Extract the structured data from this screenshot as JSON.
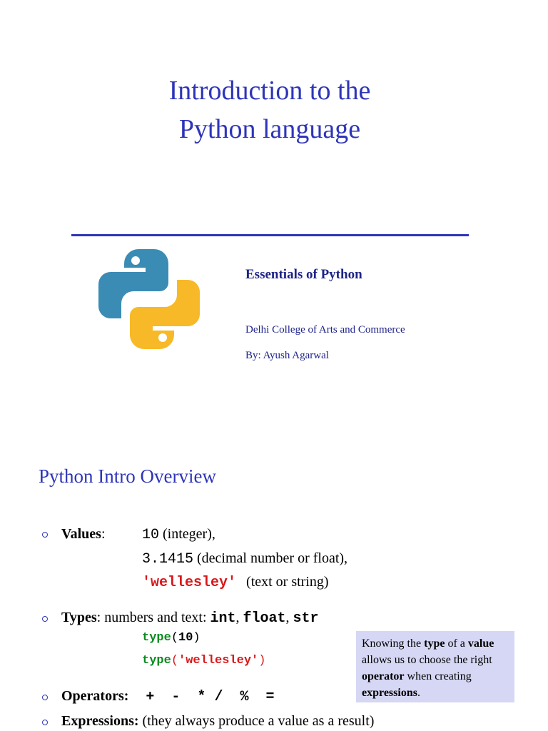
{
  "slide1": {
    "title_line1": "Introduction to the",
    "title_line2": "Python language",
    "subtitle": "Essentials of Python",
    "college": "Delhi College of Arts and Commerce",
    "author": "By: Ayush Agarwal",
    "logo_icon": "python-logo-icon",
    "colors": {
      "title": "#2e35b8",
      "logo_blue": "#3b8cb5",
      "logo_yellow": "#f7b928"
    }
  },
  "slide2": {
    "title": "Python Intro Overview",
    "values": {
      "label": "Values",
      "colon": ":",
      "v1": "10",
      "v1_desc": " (integer),",
      "v2": "3.1415",
      "v2_desc": " (decimal number or float),",
      "v3": "'wellesley'",
      "v3_desc": "(text or string)"
    },
    "types": {
      "label": "Types",
      "text": ": numbers and text: ",
      "t1": "int",
      "sep1": ", ",
      "t2": "float",
      "sep2": ", ",
      "t3": "str",
      "code1_fn": "type",
      "code1_open": "(",
      "code1_arg": "10",
      "code1_close": ")",
      "code2_fn": "type",
      "code2_open": "(",
      "code2_arg": "'wellesley'",
      "code2_close": ")"
    },
    "operators": {
      "label": "Operators:",
      "symbols": "+  -  * /  %  ="
    },
    "expressions": {
      "label": "Expressions:",
      "text": " (they always produce a value as a result)"
    },
    "callout": {
      "p1": "Knowing the ",
      "b1": "type",
      "p2": " of a ",
      "b2": "value",
      "p3": " allows us to choose the right ",
      "b3": "operator",
      "p4": " when creating ",
      "b4": "expressions",
      "p5": "."
    }
  }
}
